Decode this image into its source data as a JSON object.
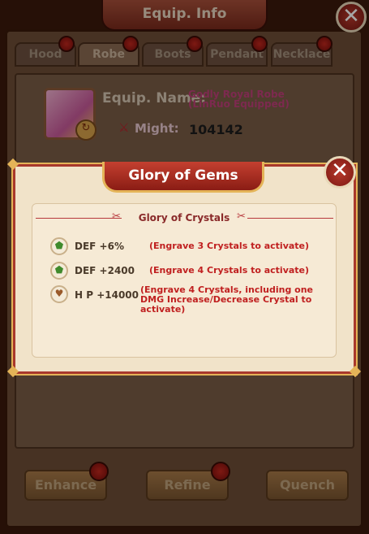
{
  "window": {
    "title": "Equip. Info"
  },
  "tabs": [
    {
      "label": "Hood"
    },
    {
      "label": "Robe"
    },
    {
      "label": "Boots"
    },
    {
      "label": "Pendant"
    },
    {
      "label": "Necklace"
    }
  ],
  "equip": {
    "name_label": "Equip. Name:",
    "name_value": "Godly Royal Robe  (LinRuo Equipped)",
    "might_label": "Might:",
    "might_value": "104142"
  },
  "buttons": {
    "enhance": "Enhance",
    "refine": "Refine",
    "quench": "Quench"
  },
  "popup": {
    "title": "Glory of Gems",
    "subtitle": "Glory of Crystals",
    "bonuses": [
      {
        "stat": "DEF +6%",
        "requirement": "(Engrave 3 Crystals to activate)",
        "icon": "green-gem-icon",
        "color": "#3f8a2c"
      },
      {
        "stat": "DEF +2400",
        "requirement": "(Engrave 4 Crystals to activate)",
        "icon": "green-gem-icon",
        "color": "#3f8a2c"
      },
      {
        "stat": "H P +14000",
        "requirement": "(Engrave 4 Crystals, including one DMG Increase/Decrease Crystal to activate)",
        "icon": "heart-icon",
        "color": "#9a5a2a"
      }
    ]
  },
  "colors": {
    "accent": "#a8382c",
    "gold": "#e4b458",
    "parchment": "#f1e3c9"
  }
}
